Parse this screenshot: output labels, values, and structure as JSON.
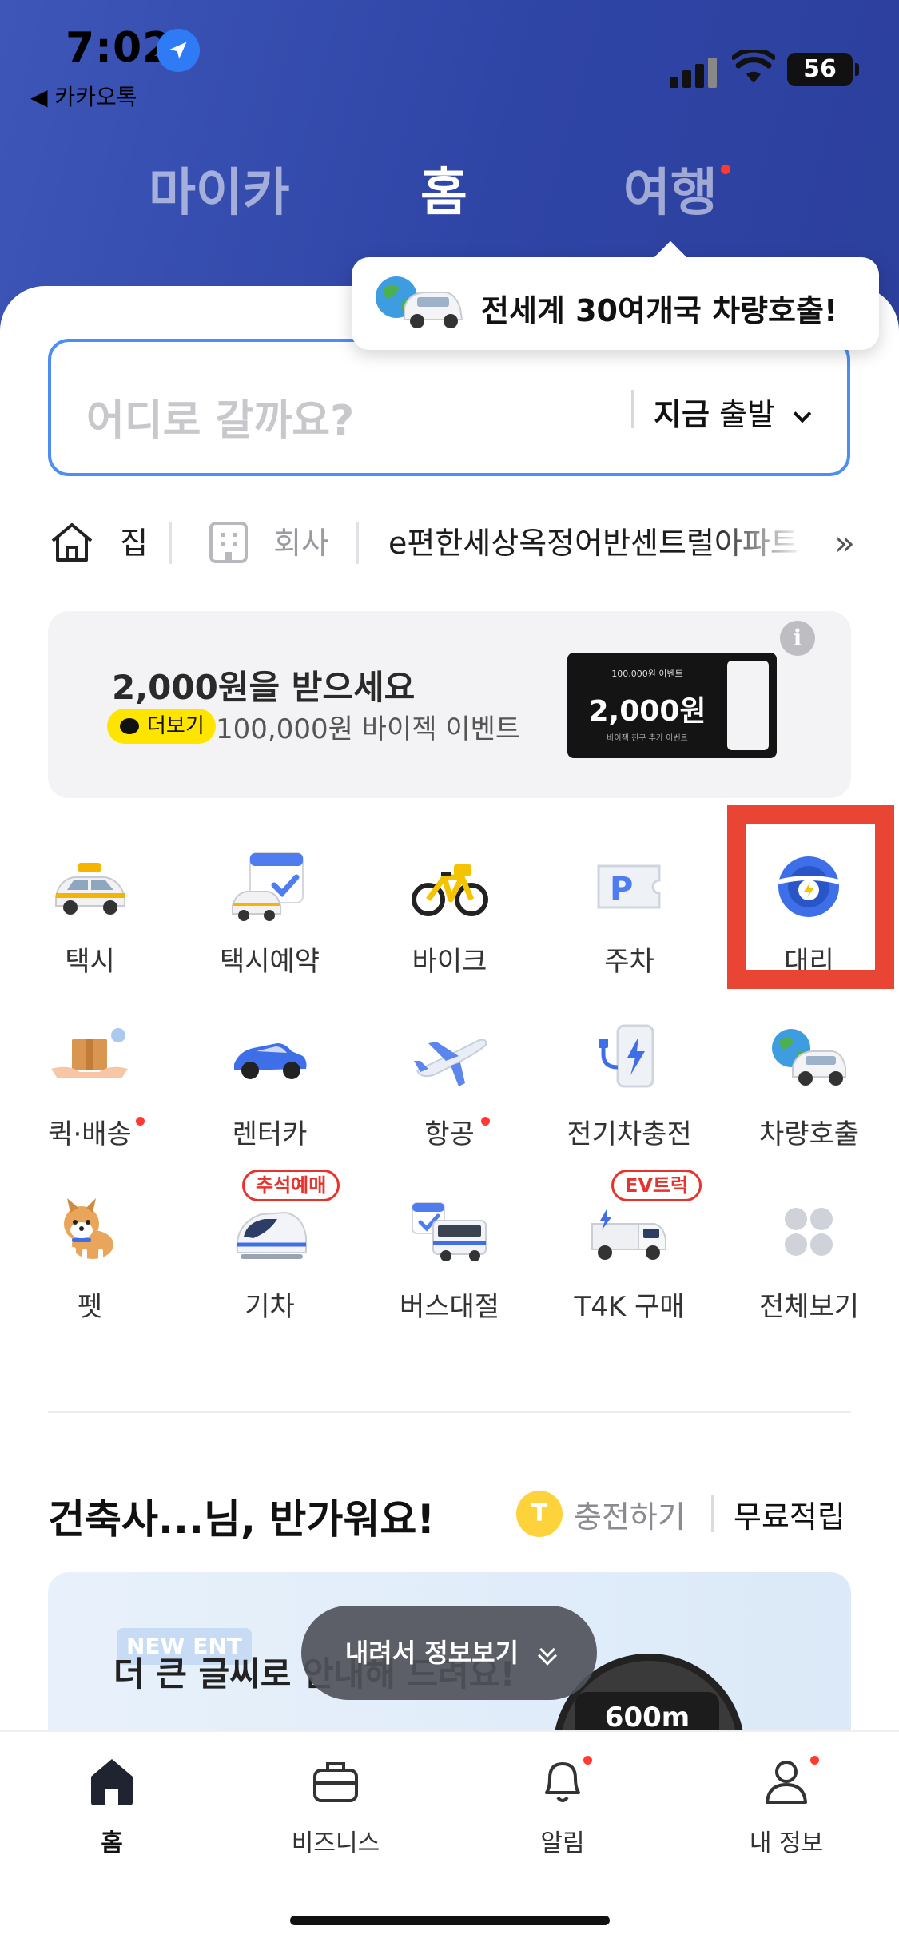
{
  "status_bar": {
    "time": "7:02",
    "back_app": "◀ 카카오톡",
    "battery": "56"
  },
  "tabs": [
    {
      "label": "마이카",
      "active": false
    },
    {
      "label": "홈",
      "active": true
    },
    {
      "label": "여행",
      "active": false,
      "has_dot": true
    }
  ],
  "tooltip": {
    "text": "전세계 30여개국 차량호출!"
  },
  "search": {
    "placeholder": "어디로 갈까요?",
    "time_bold": "지금",
    "time_rest": "출발"
  },
  "shortcuts": {
    "home": "집",
    "work": "회사",
    "recent": "e편한세상옥정어반센트럴아파트",
    "more": "»"
  },
  "promo": {
    "title": "2,000원을 받으세요",
    "tag": "더보기",
    "subtitle": "100,000원 바이젝 이벤트",
    "ticket_top": "100,000원 이벤트",
    "ticket_amount": "2,000원",
    "ticket_bottom": "바이젝 친구 추가 이벤트",
    "info": "i"
  },
  "services": [
    {
      "label": "택시",
      "icon": "taxi-icon"
    },
    {
      "label": "택시예약",
      "icon": "taxi-reservation-icon"
    },
    {
      "label": "바이크",
      "icon": "bike-icon"
    },
    {
      "label": "주차",
      "icon": "parking-icon"
    },
    {
      "label": "대리",
      "icon": "driver-icon"
    },
    {
      "label": "퀵·배송",
      "icon": "quick-delivery-icon",
      "dot": true
    },
    {
      "label": "렌터카",
      "icon": "rental-car-icon"
    },
    {
      "label": "항공",
      "icon": "airplane-icon",
      "dot": true
    },
    {
      "label": "전기차충전",
      "icon": "ev-charger-icon"
    },
    {
      "label": "차량호출",
      "icon": "global-car-icon"
    },
    {
      "label": "펫",
      "icon": "pet-icon"
    },
    {
      "label": "기차",
      "icon": "train-icon",
      "tag": "추석예매"
    },
    {
      "label": "버스대절",
      "icon": "bus-charter-icon"
    },
    {
      "label": "T4K 구매",
      "icon": "truck-icon",
      "tag": "EV트럭"
    },
    {
      "label": "전체보기",
      "icon": "view-all-icon"
    }
  ],
  "greeting": {
    "text": "건축사...님, 반가워요!",
    "coin": "T",
    "charge": "충전하기",
    "save": "무료적립"
  },
  "banner": {
    "badge": "NEW ENT",
    "text": "더 큰 글씨로 안내해 드려요!",
    "nav_pill": "600m"
  },
  "float_button": {
    "label": "내려서 정보보기"
  },
  "bottom_nav": [
    {
      "label": "홈",
      "icon": "home-icon",
      "active": true
    },
    {
      "label": "비즈니스",
      "icon": "briefcase-icon"
    },
    {
      "label": "알림",
      "icon": "bell-icon",
      "dot": true
    },
    {
      "label": "내 정보",
      "icon": "profile-icon",
      "dot": true
    }
  ],
  "colors": {
    "header": "#3d56b8",
    "accent": "#4d8ef5",
    "highlight": "#e84535",
    "badge_red": "#e8322c",
    "kakao_yellow": "#fee500"
  }
}
